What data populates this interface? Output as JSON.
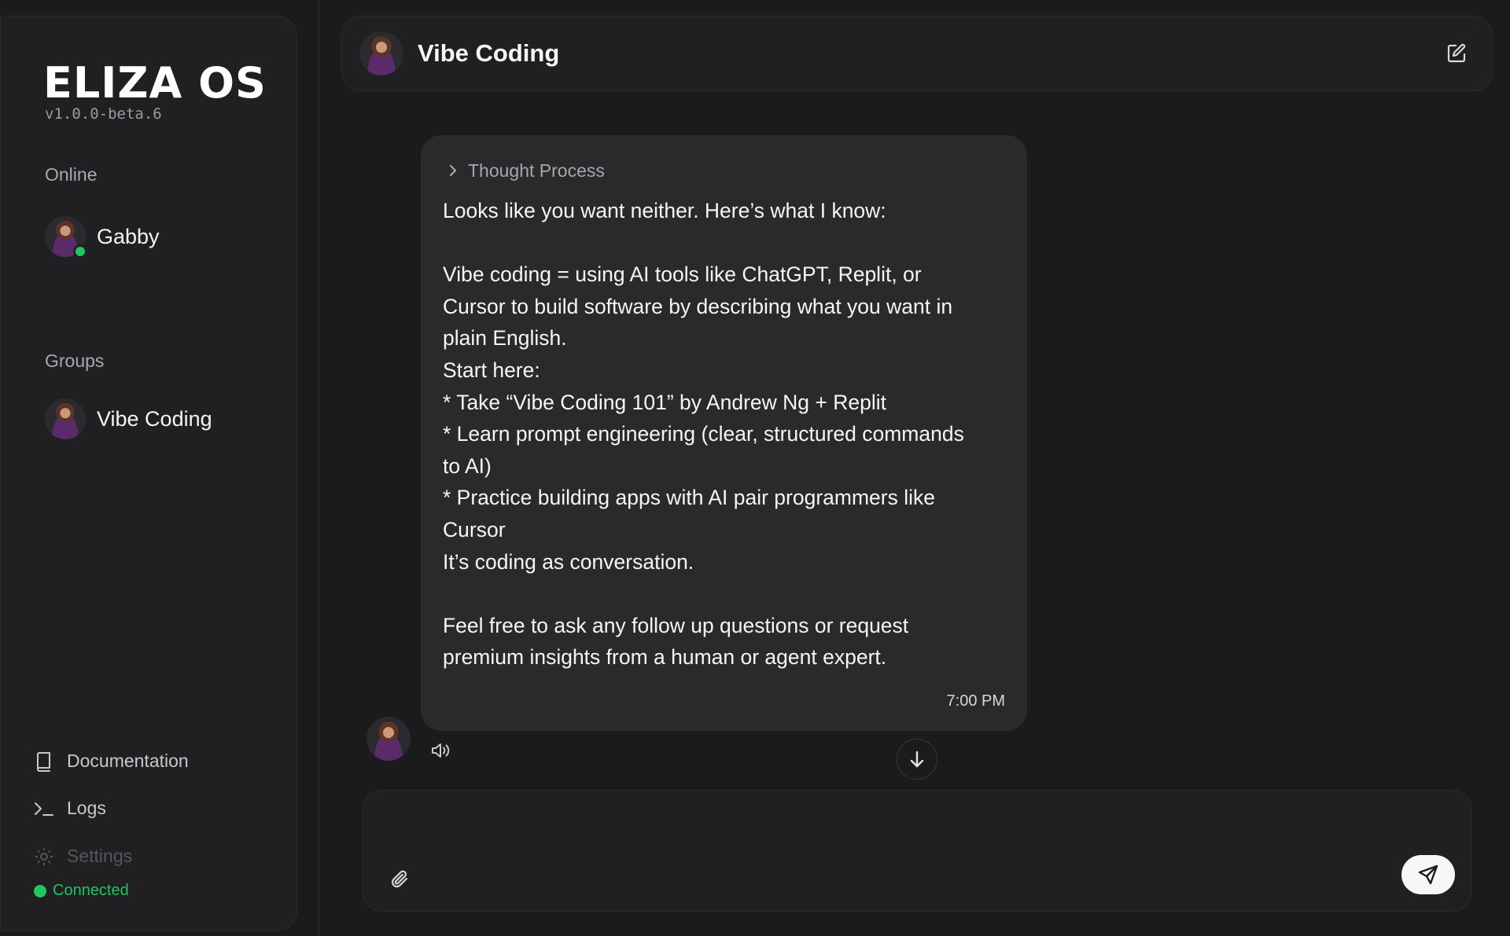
{
  "app": {
    "logo": "ELIZA OS",
    "version": "v1.0.0-beta.6"
  },
  "sidebar": {
    "online_title": "Online",
    "agents": [
      {
        "name": "Gabby",
        "status": "online",
        "avatar_icon": "agent-avatar"
      }
    ],
    "groups_title": "Groups",
    "groups": [
      {
        "name": "Vibe Coding",
        "avatar_icon": "group-avatar"
      }
    ],
    "footer_items": [
      {
        "label": "Documentation",
        "icon": "book-icon",
        "enabled": true
      },
      {
        "label": "Logs",
        "icon": "terminal-icon",
        "enabled": true
      },
      {
        "label": "Settings",
        "icon": "gear-icon",
        "enabled": false
      }
    ],
    "connection_status": "Connected",
    "connection_color": "#22c55e"
  },
  "header": {
    "title": "Vibe Coding",
    "edit_icon": "edit-icon"
  },
  "message": {
    "thought_label": "Thought Process",
    "text": "Looks like you want neither. Here’s what I know:\n\nVibe coding = using AI tools like ChatGPT, Replit, or\nCursor to build software by describing what you want in\nplain English.\nStart here:\n* Take “Vibe Coding 101” by Andrew Ng + Replit\n* Learn prompt engineering (clear, structured commands\nto AI)\n* Practice building apps with AI pair programmers like\nCursor\nIt’s coding as conversation.\n\nFeel free to ask any follow up questions or request\npremium insights from a human or agent expert.",
    "time": "7:00 PM"
  },
  "composer": {
    "value": "",
    "placeholder": "",
    "attach_icon": "paperclip-icon",
    "send_icon": "send-icon"
  },
  "colors": {
    "background": "#1b1b1d",
    "panel": "#202023",
    "bubble": "#2a2a2d",
    "accent_green": "#22c55e"
  }
}
